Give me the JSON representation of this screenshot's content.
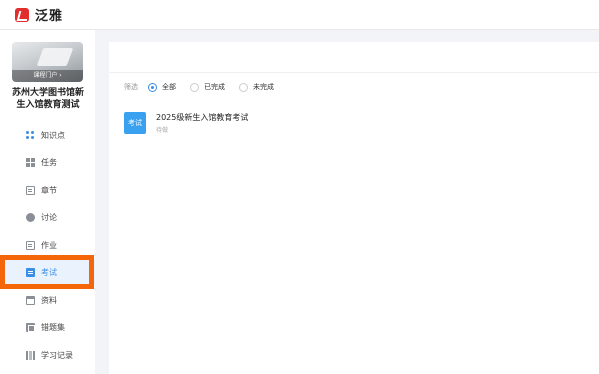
{
  "header": {
    "app_name": "泛雅",
    "brand_color": "#e02d2d"
  },
  "sidebar": {
    "cover_caption": "课程门户 ›",
    "course_title": "苏州大学图书馆新生入馆教育测试",
    "items": [
      {
        "label": "知识点",
        "icon": "knowledge-icon"
      },
      {
        "label": "任务",
        "icon": "task-icon"
      },
      {
        "label": "章节",
        "icon": "chapter-icon"
      },
      {
        "label": "讨论",
        "icon": "discussion-icon"
      },
      {
        "label": "作业",
        "icon": "homework-icon"
      },
      {
        "label": "考试",
        "icon": "exam-icon",
        "active": true
      },
      {
        "label": "资料",
        "icon": "resource-icon"
      },
      {
        "label": "错题集",
        "icon": "wrong-question-icon"
      },
      {
        "label": "学习记录",
        "icon": "study-record-icon"
      }
    ],
    "highlight_color": "#f5660b"
  },
  "main": {
    "filter": {
      "label": "筛选",
      "options": [
        "全部",
        "已完成",
        "未完成"
      ],
      "selected": "全部"
    },
    "exams": [
      {
        "badge": "考试",
        "title": "2025级新生入馆教育考试",
        "status": "待做"
      }
    ],
    "accent_color": "#3a8ee6"
  }
}
